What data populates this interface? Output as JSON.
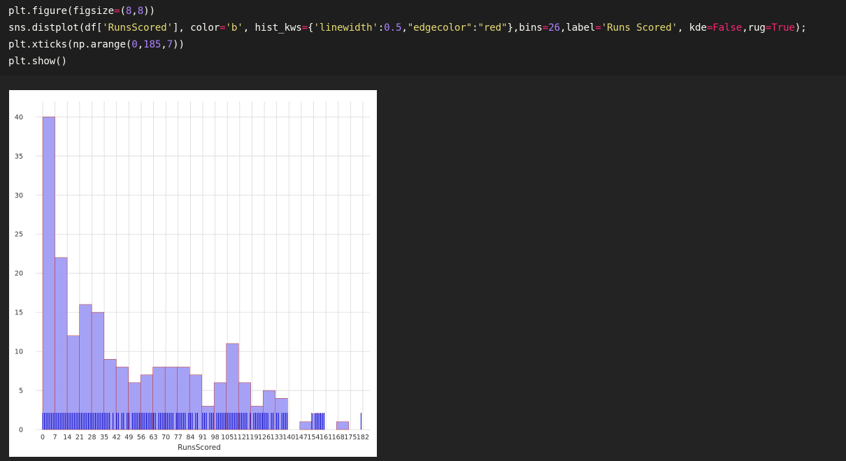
{
  "code_cell": {
    "lines": [
      [
        {
          "t": "plt.figure(figsize",
          "c": "plain"
        },
        {
          "t": "=",
          "c": "op"
        },
        {
          "t": "(",
          "c": "plain"
        },
        {
          "t": "8",
          "c": "num"
        },
        {
          "t": ",",
          "c": "plain"
        },
        {
          "t": "8",
          "c": "num"
        },
        {
          "t": "))",
          "c": "plain"
        }
      ],
      [
        {
          "t": "sns.distplot(df[",
          "c": "plain"
        },
        {
          "t": "'RunsScored'",
          "c": "str"
        },
        {
          "t": "], color",
          "c": "plain"
        },
        {
          "t": "=",
          "c": "op"
        },
        {
          "t": "'b'",
          "c": "str"
        },
        {
          "t": ", hist_kws",
          "c": "plain"
        },
        {
          "t": "=",
          "c": "op"
        },
        {
          "t": "{",
          "c": "plain"
        },
        {
          "t": "'linewidth'",
          "c": "str"
        },
        {
          "t": ":",
          "c": "plain"
        },
        {
          "t": "0.5",
          "c": "num"
        },
        {
          "t": ",",
          "c": "plain"
        },
        {
          "t": "\"edgecolor\"",
          "c": "str"
        },
        {
          "t": ":",
          "c": "plain"
        },
        {
          "t": "\"red\"",
          "c": "str"
        },
        {
          "t": "},bins",
          "c": "plain"
        },
        {
          "t": "=",
          "c": "op"
        },
        {
          "t": "26",
          "c": "num"
        },
        {
          "t": ",label",
          "c": "plain"
        },
        {
          "t": "=",
          "c": "op"
        },
        {
          "t": "'Runs Scored'",
          "c": "str"
        },
        {
          "t": ", kde",
          "c": "plain"
        },
        {
          "t": "=",
          "c": "op"
        },
        {
          "t": "False",
          "c": "kw"
        },
        {
          "t": ",rug",
          "c": "plain"
        },
        {
          "t": "=",
          "c": "op"
        },
        {
          "t": "True",
          "c": "kw"
        },
        {
          "t": ");",
          "c": "plain"
        }
      ],
      [
        {
          "t": "plt.xticks(np.arange(",
          "c": "plain"
        },
        {
          "t": "0",
          "c": "num"
        },
        {
          "t": ",",
          "c": "plain"
        },
        {
          "t": "185",
          "c": "num"
        },
        {
          "t": ",",
          "c": "plain"
        },
        {
          "t": "7",
          "c": "num"
        },
        {
          "t": "))",
          "c": "plain"
        }
      ],
      [
        {
          "t": "plt.show()",
          "c": "plain"
        }
      ]
    ],
    "colors": {
      "plain": "#f8f8f2",
      "str": "#e6db74",
      "num": "#ae81ff",
      "kw": "#f92672",
      "op": "#f92672"
    }
  },
  "chart_data": {
    "type": "bar",
    "xlabel": "RunsScored",
    "ylabel": "",
    "bar_color": "#a09df5",
    "edge_color": "#c0302a",
    "rug_color": "#0000cc",
    "bin_edges": [
      0,
      6.96,
      13.92,
      20.88,
      27.84,
      34.8,
      41.76,
      48.72,
      55.68,
      62.64,
      69.6,
      76.56,
      83.52,
      90.48,
      97.44,
      104.4,
      111.36,
      118.32,
      125.28,
      132.24,
      139.2,
      146.16,
      153.12,
      160.08,
      167.04,
      174.0,
      181.0
    ],
    "values": [
      40,
      22,
      12,
      16,
      15,
      9,
      8,
      6,
      7,
      8,
      8,
      8,
      7,
      3,
      6,
      11,
      6,
      3,
      5,
      4,
      0,
      1,
      2,
      0,
      1,
      0
    ],
    "xticks": [
      0,
      7,
      14,
      21,
      28,
      35,
      42,
      49,
      56,
      63,
      70,
      77,
      84,
      91,
      98,
      105,
      112,
      119,
      126,
      133,
      140,
      147,
      154,
      161,
      168,
      175,
      182
    ],
    "yticks": [
      0,
      5,
      10,
      15,
      20,
      25,
      30,
      35,
      40
    ],
    "xlim": [
      -4,
      186
    ],
    "ylim": [
      0,
      42
    ],
    "grid": true,
    "rug_values": [
      0,
      1,
      2,
      3,
      4,
      5,
      6,
      7,
      8,
      9,
      10,
      11,
      12,
      13,
      14,
      15,
      16,
      17,
      18,
      19,
      20,
      21,
      22,
      23,
      24,
      25,
      26,
      27,
      28,
      29,
      30,
      31,
      32,
      33,
      34,
      35,
      36,
      37,
      38,
      40,
      42,
      43,
      45,
      46,
      48,
      49,
      51,
      52,
      53,
      54,
      55,
      56,
      57,
      58,
      59,
      60,
      61,
      62,
      63,
      64,
      66,
      67,
      68,
      69,
      70,
      71,
      72,
      73,
      74,
      76,
      77,
      78,
      79,
      80,
      81,
      83,
      84,
      85,
      87,
      88,
      91,
      92,
      93,
      95,
      96,
      97,
      99,
      100,
      101,
      102,
      103,
      104,
      105,
      106,
      107,
      108,
      109,
      110,
      111,
      112,
      113,
      114,
      115,
      116,
      118,
      120,
      121,
      122,
      123,
      124,
      125,
      126,
      127,
      128,
      130,
      131,
      133,
      134,
      136,
      137,
      138,
      139,
      153,
      155,
      156,
      157,
      158,
      159,
      160,
      181
    ]
  }
}
